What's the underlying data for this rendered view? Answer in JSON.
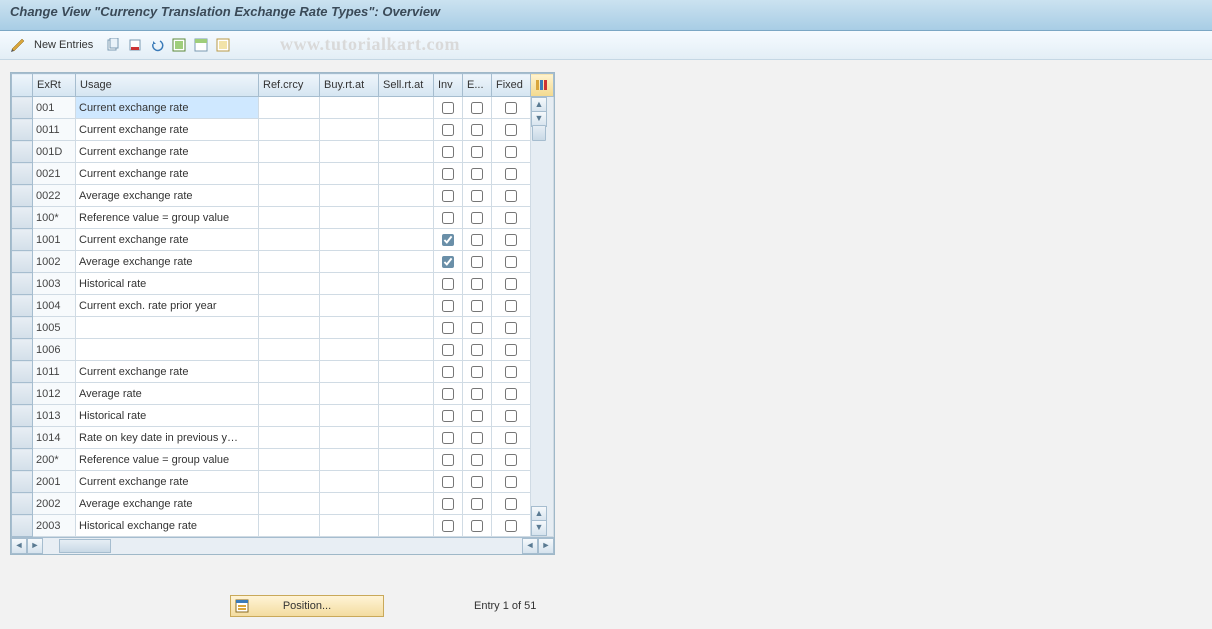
{
  "title": "Change View \"Currency Translation Exchange Rate Types\": Overview",
  "watermark": "www.tutorialkart.com",
  "toolbar": {
    "new_entries_label": "New Entries",
    "icons": {
      "toggle": "toggle-display-change-icon",
      "copy": "copy-as-icon",
      "delete": "delete-icon",
      "undo": "undo-change-icon",
      "select_all": "select-all-icon",
      "select_block": "select-block-icon",
      "deselect_all": "deselect-all-icon"
    }
  },
  "columns": {
    "exrt": "ExRt",
    "usage": "Usage",
    "refcrcy": "Ref.crcy",
    "buy": "Buy.rt.at",
    "sell": "Sell.rt.at",
    "inv": "Inv",
    "e": "E...",
    "fixed": "Fixed"
  },
  "rows": [
    {
      "exrt": "001",
      "usage": "Current exchange rate",
      "refcrcy": "",
      "buy": "",
      "sell": "",
      "inv": false,
      "e": false,
      "fixed": false,
      "highlight": true
    },
    {
      "exrt": "0011",
      "usage": "Current exchange rate",
      "refcrcy": "",
      "buy": "",
      "sell": "",
      "inv": false,
      "e": false,
      "fixed": false
    },
    {
      "exrt": "001D",
      "usage": "Current exchange rate",
      "refcrcy": "",
      "buy": "",
      "sell": "",
      "inv": false,
      "e": false,
      "fixed": false
    },
    {
      "exrt": "0021",
      "usage": "Current exchange rate",
      "refcrcy": "",
      "buy": "",
      "sell": "",
      "inv": false,
      "e": false,
      "fixed": false
    },
    {
      "exrt": "0022",
      "usage": "Average exchange rate",
      "refcrcy": "",
      "buy": "",
      "sell": "",
      "inv": false,
      "e": false,
      "fixed": false
    },
    {
      "exrt": "100*",
      "usage": "Reference value = group value",
      "refcrcy": "",
      "buy": "",
      "sell": "",
      "inv": false,
      "e": false,
      "fixed": false
    },
    {
      "exrt": "1001",
      "usage": "Current exchange rate",
      "refcrcy": "",
      "buy": "",
      "sell": "",
      "inv": true,
      "e": false,
      "fixed": false
    },
    {
      "exrt": "1002",
      "usage": "Average exchange rate",
      "refcrcy": "",
      "buy": "",
      "sell": "",
      "inv": true,
      "e": false,
      "fixed": false
    },
    {
      "exrt": "1003",
      "usage": "Historical rate",
      "refcrcy": "",
      "buy": "",
      "sell": "",
      "inv": false,
      "e": false,
      "fixed": false
    },
    {
      "exrt": "1004",
      "usage": "Current exch. rate prior year",
      "refcrcy": "",
      "buy": "",
      "sell": "",
      "inv": false,
      "e": false,
      "fixed": false
    },
    {
      "exrt": "1005",
      "usage": "",
      "refcrcy": "",
      "buy": "",
      "sell": "",
      "inv": false,
      "e": false,
      "fixed": false
    },
    {
      "exrt": "1006",
      "usage": "",
      "refcrcy": "",
      "buy": "",
      "sell": "",
      "inv": false,
      "e": false,
      "fixed": false
    },
    {
      "exrt": "1011",
      "usage": "Current exchange rate",
      "refcrcy": "",
      "buy": "",
      "sell": "",
      "inv": false,
      "e": false,
      "fixed": false
    },
    {
      "exrt": "1012",
      "usage": "Average rate",
      "refcrcy": "",
      "buy": "",
      "sell": "",
      "inv": false,
      "e": false,
      "fixed": false
    },
    {
      "exrt": "1013",
      "usage": "Historical rate",
      "refcrcy": "",
      "buy": "",
      "sell": "",
      "inv": false,
      "e": false,
      "fixed": false
    },
    {
      "exrt": "1014",
      "usage": "Rate on key date in previous y…",
      "refcrcy": "",
      "buy": "",
      "sell": "",
      "inv": false,
      "e": false,
      "fixed": false
    },
    {
      "exrt": "200*",
      "usage": "Reference value = group value",
      "refcrcy": "",
      "buy": "",
      "sell": "",
      "inv": false,
      "e": false,
      "fixed": false
    },
    {
      "exrt": "2001",
      "usage": "Current exchange rate",
      "refcrcy": "",
      "buy": "",
      "sell": "",
      "inv": false,
      "e": false,
      "fixed": false
    },
    {
      "exrt": "2002",
      "usage": "Average exchange rate",
      "refcrcy": "",
      "buy": "",
      "sell": "",
      "inv": false,
      "e": false,
      "fixed": false
    },
    {
      "exrt": "2003",
      "usage": "Historical exchange rate",
      "refcrcy": "",
      "buy": "",
      "sell": "",
      "inv": false,
      "e": false,
      "fixed": false
    }
  ],
  "footer": {
    "position_button": "Position...",
    "entry_status": "Entry 1 of 51"
  }
}
